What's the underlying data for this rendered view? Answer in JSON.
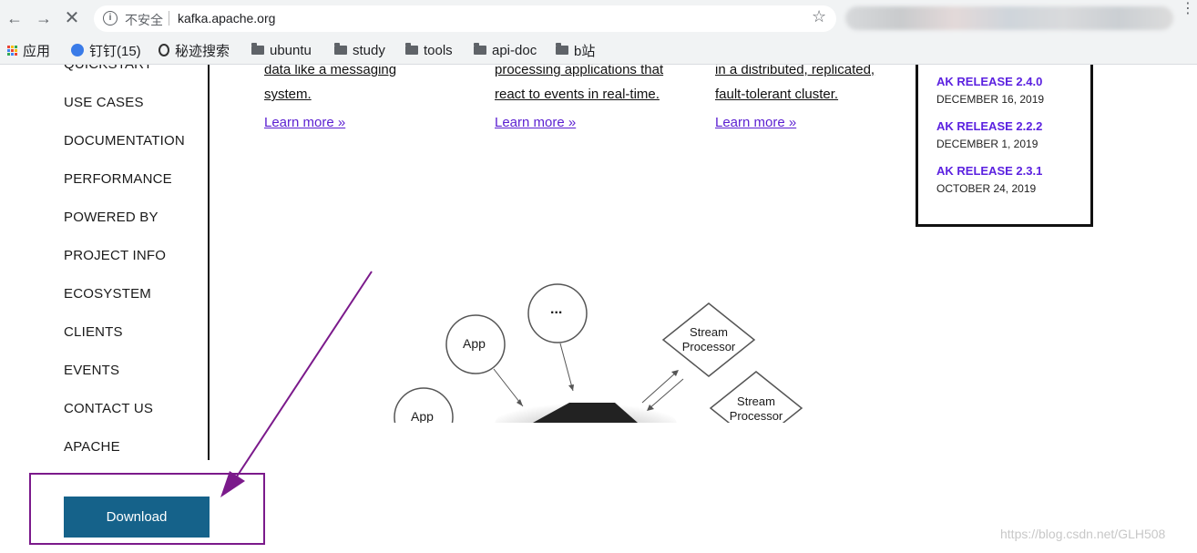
{
  "browser": {
    "security_label": "不安全",
    "url": "kafka.apache.org",
    "bookmarks": [
      {
        "label": "应用",
        "icon": "apps-grid-icon"
      },
      {
        "label": "钉钉(15)",
        "icon": "dingtalk-icon"
      },
      {
        "label": "秘迹搜索",
        "icon": "mijisou-icon"
      },
      {
        "label": "ubuntu",
        "icon": "folder-icon"
      },
      {
        "label": "study",
        "icon": "folder-icon"
      },
      {
        "label": "tools",
        "icon": "folder-icon"
      },
      {
        "label": "api-doc",
        "icon": "folder-icon"
      },
      {
        "label": "b站",
        "icon": "folder-icon"
      }
    ]
  },
  "sidebar": {
    "items": [
      "QUICKSTART",
      "USE CASES",
      "DOCUMENTATION",
      "PERFORMANCE",
      "POWERED BY",
      "PROJECT INFO",
      "ECOSYSTEM",
      "CLIENTS",
      "EVENTS",
      "CONTACT US",
      "APACHE"
    ],
    "download_label": "Download"
  },
  "features": [
    {
      "line1": "data like a messaging",
      "line2": "system.",
      "link": "Learn more »"
    },
    {
      "line1": "processing applications that",
      "line2": "react to events in real-time.",
      "link": "Learn more »"
    },
    {
      "line1": "in a distributed, replicated,",
      "line2": "fault-tolerant cluster.",
      "link": "Learn more »"
    }
  ],
  "news": [
    {
      "title": "AK RELEASE 2.4.0",
      "date": "DECEMBER 16, 2019"
    },
    {
      "title": "AK RELEASE 2.2.2",
      "date": "DECEMBER 1, 2019"
    },
    {
      "title": "AK RELEASE 2.3.1",
      "date": "OCTOBER 24, 2019"
    }
  ],
  "diagram": {
    "app_label": "App",
    "more_label": "...",
    "stream_line1": "Stream",
    "stream_line2": "Processor"
  },
  "watermark": "https://blog.csdn.net/GLH508",
  "colors": {
    "download_button": "#15628a",
    "annotation": "#7b1a8b",
    "link": "#5b1fd1"
  }
}
